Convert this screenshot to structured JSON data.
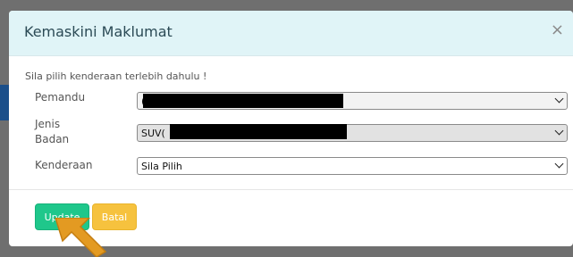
{
  "modal": {
    "title": "Kemaskini Maklumat",
    "close_symbol": "×",
    "notice": "Sila pilih kenderaan terlebih dahulu !"
  },
  "form": {
    "driver_label": "Pemandu",
    "driver_value": "(",
    "body_type_label": "Jenis Badan",
    "body_type_value": "SUV(",
    "vehicle_label": "Kenderaan",
    "vehicle_value": "Sila Pilih"
  },
  "buttons": {
    "update_label": "Update",
    "cancel_label": "Batal"
  },
  "colors": {
    "header_bg": "#e0f4f7",
    "update_bg": "#1fc78b",
    "cancel_bg": "#f6c23e",
    "cursor": "#e39a22"
  }
}
